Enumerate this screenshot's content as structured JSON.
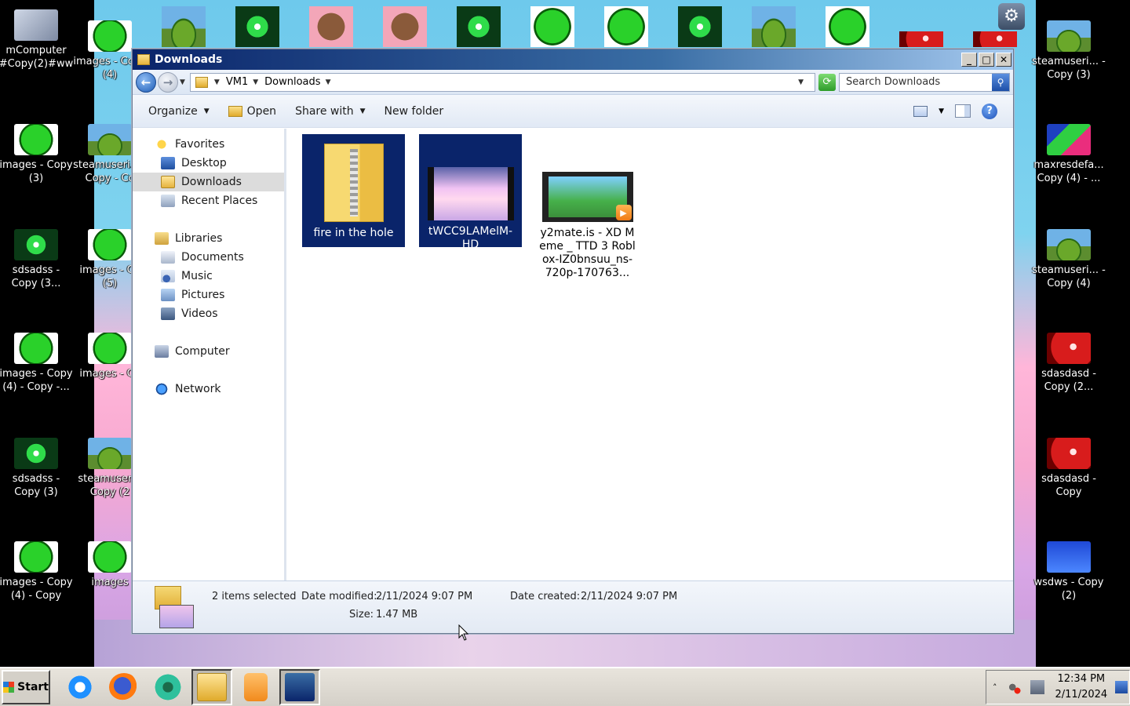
{
  "desktop": {
    "left_icons": [
      {
        "label": "mComputer #Copy(2)#ww",
        "thumb": "t-pc"
      },
      {
        "label": "images - Copy (4)",
        "thumb": "t-green"
      },
      {
        "label": "images - Copy (3)",
        "thumb": "t-green"
      },
      {
        "label": "steamuseri... - Copy - Co",
        "thumb": "t-blob"
      },
      {
        "label": "sdsadss - Copy (3...",
        "thumb": "t-burst"
      },
      {
        "label": "images - Co (5)",
        "thumb": "t-green"
      },
      {
        "label": "images - Copy (4) - Copy -...",
        "thumb": "t-green"
      },
      {
        "label": "images - Co",
        "thumb": "t-green"
      },
      {
        "label": "sdsadss - Copy (3)",
        "thumb": "t-burst"
      },
      {
        "label": "steamuseri - Copy (2",
        "thumb": "t-blob"
      },
      {
        "label": "images - Copy (4) - Copy",
        "thumb": "t-green"
      },
      {
        "label": "images",
        "thumb": "t-green"
      }
    ],
    "right_icons": [
      {
        "label": "steamuseri... - Copy (3)",
        "thumb": "t-blob"
      },
      {
        "label": "maxresdefa... Copy (4) - ...",
        "thumb": "t-multi"
      },
      {
        "label": "steamuseri... - Copy (4)",
        "thumb": "t-blob"
      },
      {
        "label": "sdasdasd - Copy (2...",
        "thumb": "t-red"
      },
      {
        "label": "sdasdasd - Copy",
        "thumb": "t-red"
      },
      {
        "label": "wsdws - Copy (2)",
        "thumb": "t-blue"
      }
    ]
  },
  "window": {
    "title": "Downloads",
    "minimize": "_",
    "maximize": "□",
    "close": "✕",
    "breadcrumb": [
      "VM1",
      "Downloads"
    ],
    "search_placeholder": "Search Downloads",
    "toolbar": {
      "organize": "Organize",
      "open": "Open",
      "share_with": "Share with",
      "new_folder": "New folder",
      "help": "?"
    },
    "nav": {
      "favorites": "Favorites",
      "desktop": "Desktop",
      "downloads": "Downloads",
      "recent": "Recent Places",
      "libraries": "Libraries",
      "documents": "Documents",
      "music": "Music",
      "pictures": "Pictures",
      "videos": "Videos",
      "computer": "Computer",
      "network": "Network"
    },
    "files": [
      {
        "name": "fire in the hole",
        "type": "zip",
        "selected": true
      },
      {
        "name": "tWCC9LAMelM-HD",
        "type": "video",
        "selected": true
      },
      {
        "name": "y2mate.is - XD Meme _ TTD 3 Roblox-IZ0bnsuu_ns-720p-170763...",
        "type": "video",
        "selected": false
      }
    ],
    "details": {
      "selection": "2 items selected",
      "modified_label": "Date modified:",
      "modified_value": "2/11/2024 9:07 PM",
      "created_label": "Date created:",
      "created_value": "2/11/2024 9:07 PM",
      "size_label": "Size:",
      "size_value": "1.47 MB"
    }
  },
  "taskbar": {
    "start": "Start",
    "time": "12:34 PM",
    "date": "2/11/2024"
  }
}
